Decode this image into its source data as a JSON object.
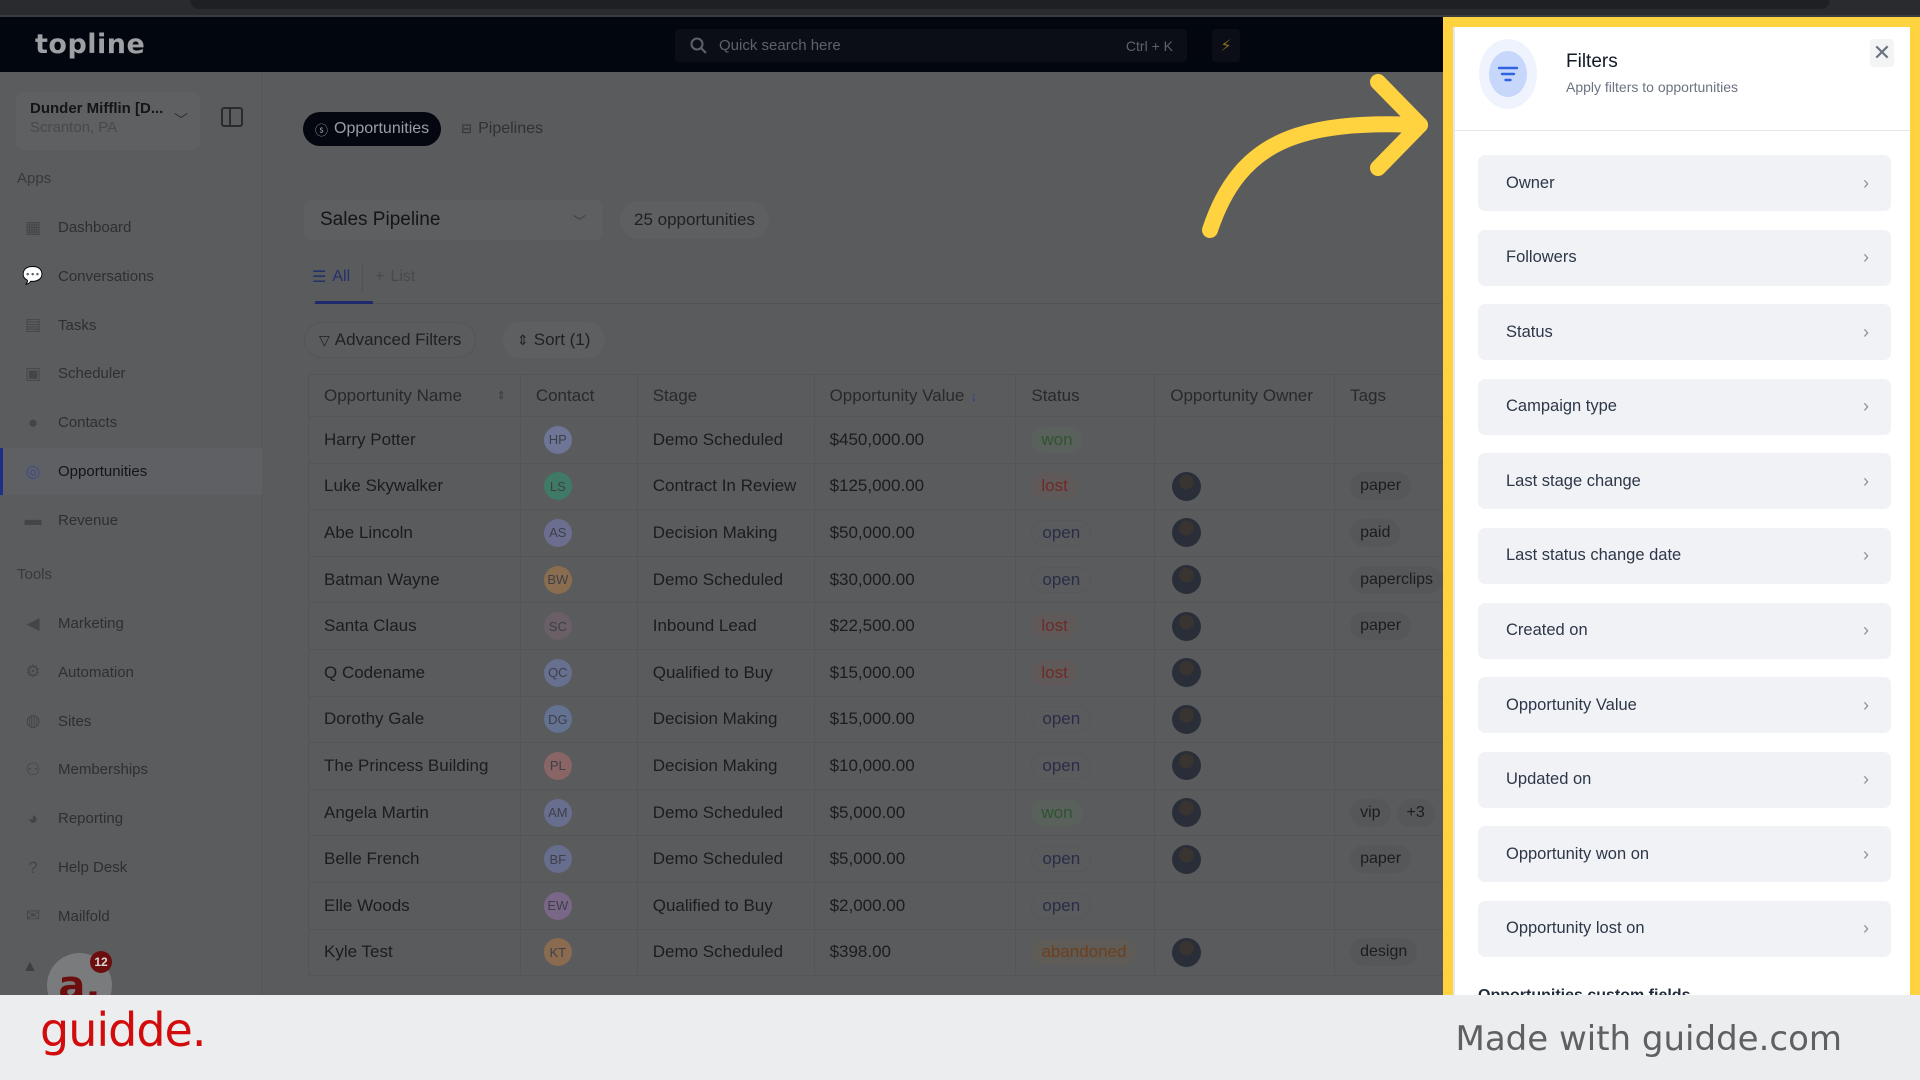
{
  "header": {
    "logo": "topline",
    "search_placeholder": "Quick search here",
    "search_shortcut": "Ctrl + K"
  },
  "sidebar": {
    "account_name": "Dunder Mifflin [D...",
    "account_location": "Scranton, PA",
    "apps_label": "Apps",
    "tools_label": "Tools",
    "apps": [
      {
        "label": "Dashboard",
        "icon": "dashboard-icon"
      },
      {
        "label": "Conversations",
        "icon": "chat-icon"
      },
      {
        "label": "Tasks",
        "icon": "task-icon"
      },
      {
        "label": "Scheduler",
        "icon": "calendar-icon"
      },
      {
        "label": "Contacts",
        "icon": "person-icon"
      },
      {
        "label": "Opportunities",
        "icon": "target-icon",
        "active": true
      },
      {
        "label": "Revenue",
        "icon": "credit-card-icon"
      }
    ],
    "tools": [
      {
        "label": "Marketing",
        "icon": "megaphone-icon"
      },
      {
        "label": "Automation",
        "icon": "gears-icon"
      },
      {
        "label": "Sites",
        "icon": "globe-icon"
      },
      {
        "label": "Memberships",
        "icon": "users-icon"
      },
      {
        "label": "Reporting",
        "icon": "pie-chart-icon"
      },
      {
        "label": "Help Desk",
        "icon": "help-icon"
      },
      {
        "label": "Mailfold",
        "icon": "mail-icon"
      }
    ],
    "help_badge_count": "12",
    "help_bubble_letter": "a."
  },
  "main": {
    "tabs": [
      {
        "label": "Opportunities",
        "active": true
      },
      {
        "label": "Pipelines",
        "active": false
      }
    ],
    "pipeline_select": "Sales Pipeline",
    "opportunity_count": "25 opportunities",
    "views": [
      {
        "label": "All",
        "active": true
      },
      {
        "label": "List",
        "active": false
      }
    ],
    "advanced_filters_label": "Advanced Filters",
    "sort_label": "Sort (1)",
    "table": {
      "columns": [
        "Opportunity Name",
        "Contact",
        "Stage",
        "Opportunity Value",
        "Status",
        "Opportunity Owner",
        "Tags"
      ],
      "rows": [
        {
          "name": "Harry Potter",
          "initials": "HP",
          "initials_color": "#6f7596",
          "stage": "Demo Scheduled",
          "value": "$450,000.00",
          "status": "won",
          "owner": false,
          "tags": []
        },
        {
          "name": "Luke Skywalker",
          "initials": "LS",
          "initials_color": "#3f7a66",
          "stage": "Contract In Review",
          "value": "$125,000.00",
          "status": "lost",
          "owner": true,
          "tags": [
            "paper"
          ]
        },
        {
          "name": "Abe Lincoln",
          "initials": "AS",
          "initials_color": "#6b6e8e",
          "stage": "Decision Making",
          "value": "$50,000.00",
          "status": "open",
          "owner": true,
          "tags": [
            "paid"
          ]
        },
        {
          "name": "Batman Wayne",
          "initials": "BW",
          "initials_color": "#8a6d4e",
          "stage": "Demo Scheduled",
          "value": "$30,000.00",
          "status": "open",
          "owner": true,
          "tags": [
            "paperclips"
          ]
        },
        {
          "name": "Santa Claus",
          "initials": "SC",
          "initials_color": "#6a5f66",
          "stage": "Inbound Lead",
          "value": "$22,500.00",
          "status": "lost",
          "owner": true,
          "tags": [
            "paper"
          ]
        },
        {
          "name": "Q Codename",
          "initials": "QC",
          "initials_color": "#67708e",
          "stage": "Qualified to Buy",
          "value": "$15,000.00",
          "status": "lost",
          "owner": true,
          "tags": []
        },
        {
          "name": "Dorothy Gale",
          "initials": "DG",
          "initials_color": "#627290",
          "stage": "Decision Making",
          "value": "$15,000.00",
          "status": "open",
          "owner": true,
          "tags": []
        },
        {
          "name": "The Princess Building",
          "initials": "PL",
          "initials_color": "#8a6566",
          "stage": "Decision Making",
          "value": "$10,000.00",
          "status": "open",
          "owner": true,
          "tags": []
        },
        {
          "name": "Angela Martin",
          "initials": "AM",
          "initials_color": "#686e8e",
          "stage": "Demo Scheduled",
          "value": "$5,000.00",
          "status": "won",
          "owner": true,
          "tags": [
            "vip",
            "+3"
          ]
        },
        {
          "name": "Belle French",
          "initials": "BF",
          "initials_color": "#666d8d",
          "stage": "Demo Scheduled",
          "value": "$5,000.00",
          "status": "open",
          "owner": true,
          "tags": [
            "paper"
          ]
        },
        {
          "name": "Elle Woods",
          "initials": "EW",
          "initials_color": "#7a6788",
          "stage": "Qualified to Buy",
          "value": "$2,000.00",
          "status": "open",
          "owner": false,
          "tags": []
        },
        {
          "name": "Kyle Test",
          "initials": "KT",
          "initials_color": "#8a6b50",
          "stage": "Demo Scheduled",
          "value": "$398.00",
          "status": "abandoned",
          "owner": true,
          "tags": [
            "design"
          ]
        }
      ]
    }
  },
  "filters_panel": {
    "title": "Filters",
    "subtitle": "Apply filters to opportunities",
    "items": [
      "Owner",
      "Followers",
      "Status",
      "Campaign type",
      "Last stage change",
      "Last status change date",
      "Created on",
      "Opportunity Value",
      "Updated on",
      "Opportunity won on",
      "Opportunity lost on"
    ],
    "section_heading": "Opportunities custom fields"
  },
  "colors": {
    "highlight": "#ffd23f",
    "guidde_brand": "#d20c0c",
    "accent_blue": "#1e2a6b"
  },
  "footer": {
    "brand": "guidde.",
    "tagline": "Made with guidde.com"
  }
}
